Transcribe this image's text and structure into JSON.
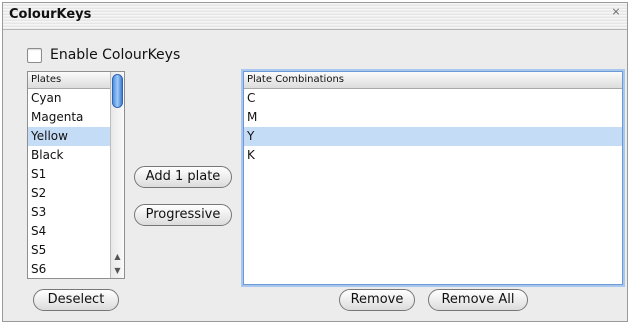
{
  "window": {
    "title": "ColourKeys",
    "close_icon": "close-icon"
  },
  "enable_checkbox": {
    "label": "Enable ColourKeys",
    "checked": false
  },
  "plates": {
    "header": "Plates",
    "items": [
      "Cyan",
      "Magenta",
      "Yellow",
      "Black",
      "S1",
      "S2",
      "S3",
      "S4",
      "S5",
      "S6"
    ],
    "selected_index": 2
  },
  "actions": {
    "add_label": "Add 1 plate",
    "progressive_label": "Progressive"
  },
  "combinations": {
    "header": "Plate Combinations",
    "items": [
      "C",
      "M",
      "Y",
      "K"
    ],
    "selected_index": 2
  },
  "bottom": {
    "deselect_label": "Deselect",
    "remove_label": "Remove",
    "remove_all_label": "Remove All"
  },
  "colors": {
    "selection": "#c5dcf7",
    "focus_ring": "#a9c7ee",
    "scroll_thumb": "#4d8fe0"
  }
}
